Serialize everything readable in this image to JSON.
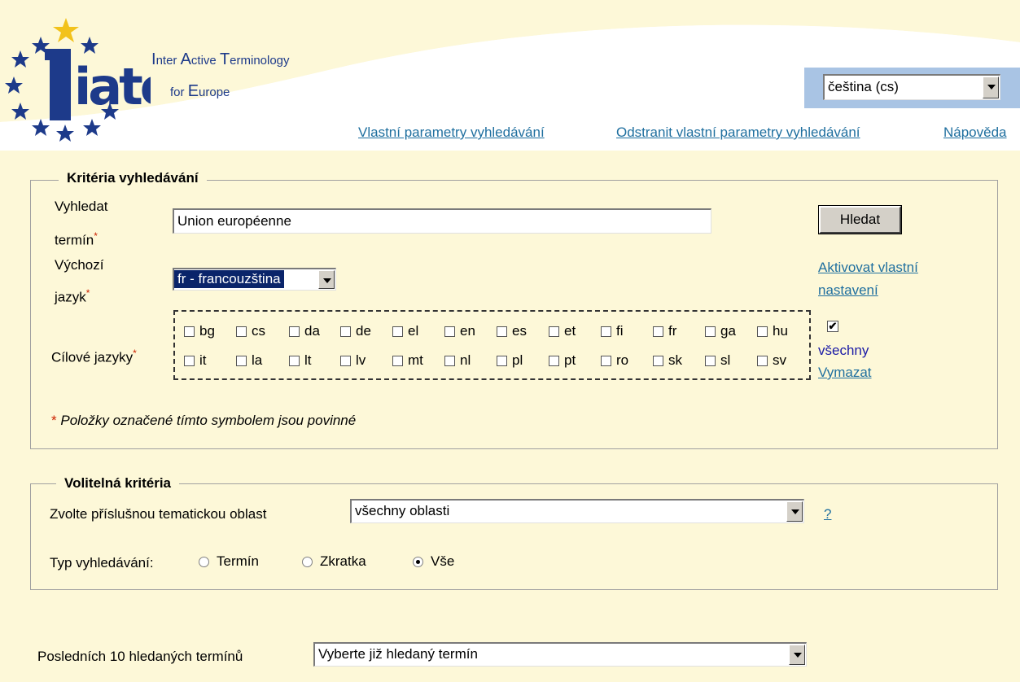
{
  "header": {
    "logo_word": "iate",
    "tagline": {
      "I": "I",
      "nter": "nter ",
      "A": "A",
      "ctive": "ctive ",
      "T": "T",
      "erminology": "erminology",
      "for": "for ",
      "E": "E",
      "urope": "urope"
    },
    "language_select": "čeština (cs)",
    "links": {
      "custom_params": "Vlastní parametry vyhledávání",
      "remove_custom_params": "Odstranit vlastní parametry vyhledávání",
      "help": "Nápověda"
    }
  },
  "search_criteria": {
    "legend": "Kritéria vyhledávání",
    "term_label_line1": "Vyhledat",
    "term_label_line2": "termín",
    "term_value": "Union européenne",
    "search_button": "Hledat",
    "source_label_line1": "Výchozí",
    "source_label_line2": "jazyk",
    "source_value": "fr - francouzština",
    "activate_line1": "Aktivovat vlastní",
    "activate_line2": "nastavení",
    "target_label": "Cílové jazyky",
    "required_mark": "*",
    "languages_row1": [
      "bg",
      "cs",
      "da",
      "de",
      "el",
      "en",
      "es",
      "et",
      "fi",
      "fr",
      "ga",
      "hu"
    ],
    "languages_row2": [
      "it",
      "la",
      "lt",
      "lv",
      "mt",
      "nl",
      "pl",
      "pt",
      "ro",
      "sk",
      "sl",
      "sv"
    ],
    "all_checked": "✔",
    "all_label": "všechny",
    "clear_label": "Vymazat",
    "required_note": "Položky označené tímto symbolem jsou povinné"
  },
  "optional_criteria": {
    "legend": "Volitelná kritéria",
    "domain_label": "Zvolte příslušnou tematickou oblast",
    "domain_value": "všechny oblasti",
    "help_link": "?",
    "search_type_label": "Typ vyhledávání:",
    "search_types": [
      "Termín",
      "Zkratka",
      "Vše"
    ],
    "search_type_selected": "Vše"
  },
  "recent": {
    "label": "Posledních 10 hledaných termínů",
    "value": "Vyberte již hledaný termín"
  },
  "colors": {
    "page_bg": "#fdf8d8",
    "link": "#1f6f9f",
    "logo_blue": "#1d3a8a",
    "star_blue": "#1d3a8a",
    "star_yellow": "#f2c21b",
    "lang_bar": "#a9c4e4",
    "required": "#cc2200"
  }
}
